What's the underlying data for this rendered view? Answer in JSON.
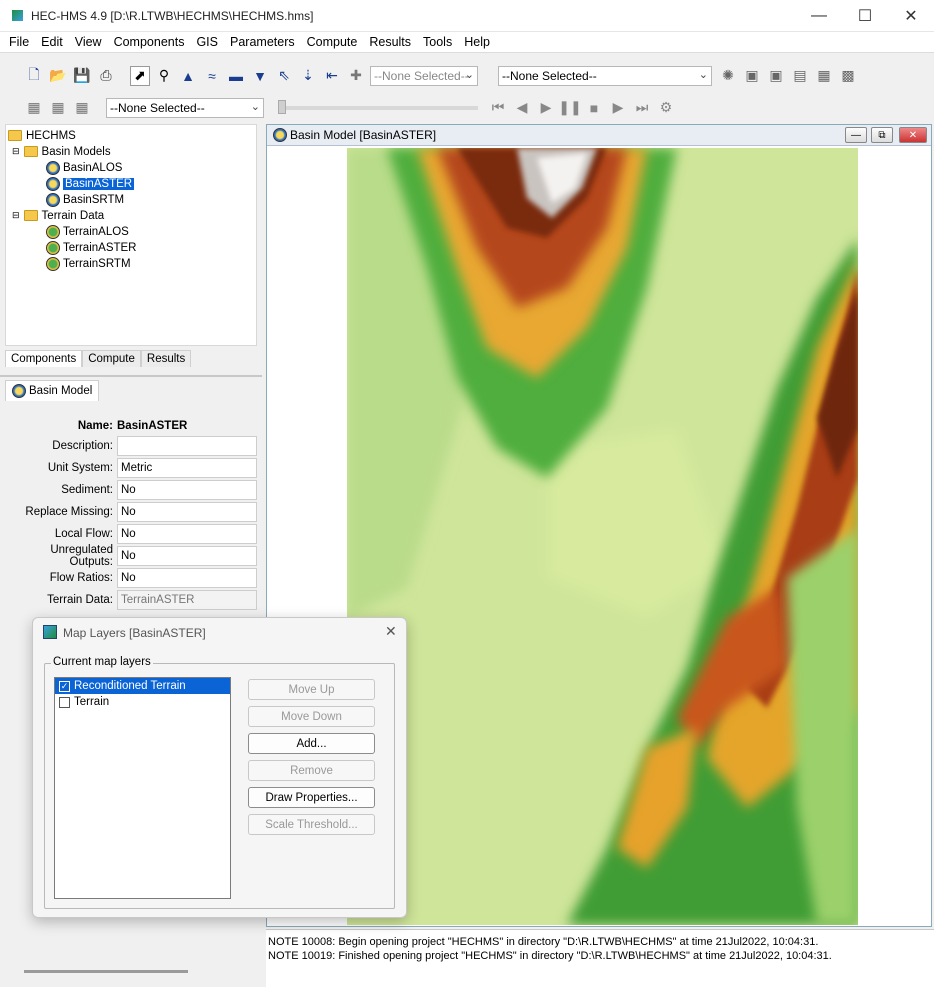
{
  "window": {
    "title": "HEC-HMS 4.9 [D:\\R.LTWB\\HECHMS\\HECHMS.hms]"
  },
  "menu": [
    "File",
    "Edit",
    "View",
    "Components",
    "GIS",
    "Parameters",
    "Compute",
    "Results",
    "Tools",
    "Help"
  ],
  "toolbar": {
    "combo1": "--None Selected--",
    "combo2": "--None Selected--",
    "combo3": "--None Selected--"
  },
  "tree": {
    "root": "HECHMS",
    "basin_models_label": "Basin Models",
    "basins": [
      "BasinALOS",
      "BasinASTER",
      "BasinSRTM"
    ],
    "terrain_label": "Terrain Data",
    "terrains": [
      "TerrainALOS",
      "TerrainASTER",
      "TerrainSRTM"
    ]
  },
  "tree_tabs": [
    "Components",
    "Compute",
    "Results"
  ],
  "props": {
    "tab": "Basin Model",
    "name_label": "Name:",
    "name_value": "BasinASTER",
    "rows": [
      {
        "label": "Description:",
        "value": ""
      },
      {
        "label": "Unit System:",
        "value": "Metric"
      },
      {
        "label": "Sediment:",
        "value": "No"
      },
      {
        "label": "Replace Missing:",
        "value": "No"
      },
      {
        "label": "Local Flow:",
        "value": "No"
      },
      {
        "label": "Unregulated Outputs:",
        "value": "No"
      },
      {
        "label": "Flow Ratios:",
        "value": "No"
      },
      {
        "label": "Terrain Data:",
        "value": "TerrainASTER"
      }
    ]
  },
  "basin_window": {
    "title": "Basin Model [BasinASTER]"
  },
  "dialog": {
    "title": "Map Layers [BasinASTER]",
    "group": "Current map layers",
    "layers": [
      {
        "name": "Reconditioned Terrain",
        "checked": true
      },
      {
        "name": "Terrain",
        "checked": false
      }
    ],
    "buttons": {
      "move_up": "Move Up",
      "move_down": "Move Down",
      "add": "Add...",
      "remove": "Remove",
      "draw": "Draw Properties...",
      "scale": "Scale Threshold..."
    }
  },
  "console": [
    "NOTE 10008:  Begin opening project \"HECHMS\" in directory \"D:\\R.LTWB\\HECHMS\" at time 21Jul2022, 10:04:31.",
    "NOTE 10019:  Finished opening project \"HECHMS\" in directory \"D:\\R.LTWB\\HECHMS\" at time 21Jul2022, 10:04:31."
  ]
}
